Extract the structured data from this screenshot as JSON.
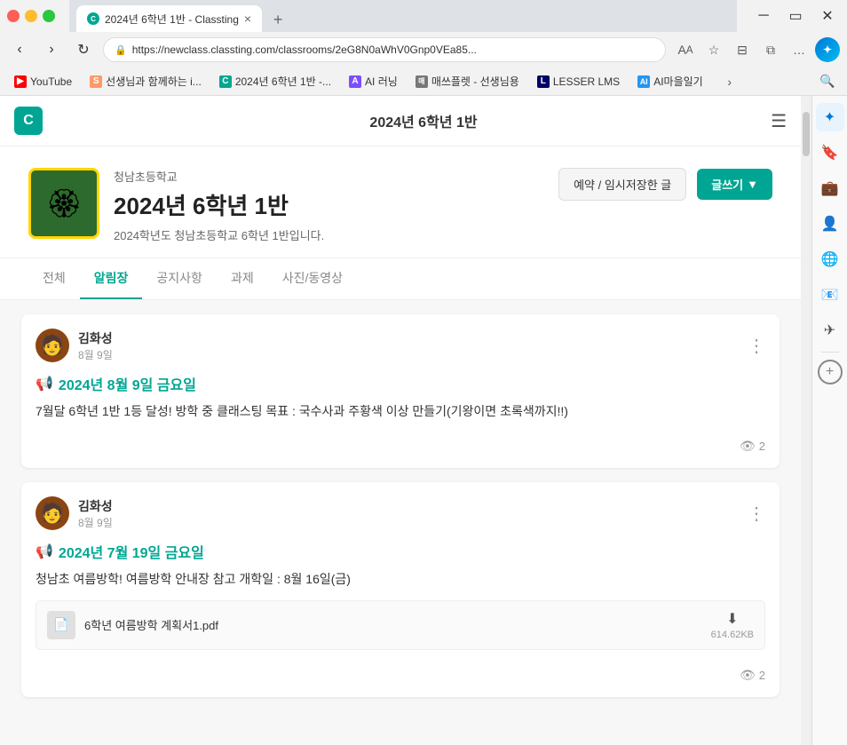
{
  "browser": {
    "tab": {
      "favicon_text": "C",
      "title": "2024년 6학년 1반 - Classting",
      "close_label": "×"
    },
    "new_tab_label": "+",
    "address": {
      "url": "https://newclass.classting.com/classrooms/2eG8N0aWhV0Gnp0VEa85...",
      "lock_icon": "🔒"
    },
    "nav": {
      "back": "‹",
      "forward": "›",
      "refresh": "↻",
      "home": "⌂"
    },
    "bar_icons": {
      "translate": "A",
      "star": "☆",
      "read": "⊟",
      "split": "⧉",
      "settings": "⚙",
      "more": "…"
    }
  },
  "bookmarks": [
    {
      "id": "youtube",
      "icon": "▶",
      "color": "bm-youtube",
      "label": "YouTube"
    },
    {
      "id": "seon",
      "icon": "S",
      "color": "bm-s",
      "label": "선생님과 함께하는 i..."
    },
    {
      "id": "classting2",
      "icon": "C",
      "color": "bm-classting",
      "label": "2024년 6학년 1반 -..."
    },
    {
      "id": "ai",
      "icon": "A",
      "color": "bm-ai",
      "label": "AI 러닝"
    },
    {
      "id": "matss",
      "icon": "매",
      "color": "bm-matss",
      "label": "매쓰플렛 - 선생님용"
    },
    {
      "id": "lesser",
      "icon": "L",
      "color": "bm-lesser",
      "label": "LESSER LMS"
    },
    {
      "id": "aimaul",
      "icon": "🤖",
      "color": "bm-ai-maul",
      "label": "AI마을일기"
    }
  ],
  "classting": {
    "logo": "C",
    "title": "2024년 6학년 1반",
    "menu_icon": "☰",
    "school": {
      "name": "청남초등학교",
      "emblem": "🏵",
      "class_name": "2024년 6학년 1반",
      "description": "2024학년도 청남초등학교 6학년 1반입니다."
    },
    "actions": {
      "draft_label": "예약 / 임시저장한 글",
      "write_label": "글쓰기",
      "write_arrow": "▼"
    },
    "tabs": [
      {
        "id": "all",
        "label": "전체"
      },
      {
        "id": "notice",
        "label": "알림장",
        "active": true
      },
      {
        "id": "announcement",
        "label": "공지사항"
      },
      {
        "id": "homework",
        "label": "과제"
      },
      {
        "id": "media",
        "label": "사진/동영상"
      }
    ],
    "posts": [
      {
        "id": "post1",
        "author": "김화성",
        "date": "8월 9일",
        "title": "2024년 8월 9일 금요일",
        "title_icon": "📢",
        "body": "7월달 6학년 1반 1등 달성! 방학 중 클래스팅 목표 : 국수사과 주황색 이상 만들기(기왕이면 초록색까지!!)",
        "views": "2",
        "attachment": null
      },
      {
        "id": "post2",
        "author": "김화성",
        "date": "8월 9일",
        "title": "2024년 7월 19일 금요일",
        "title_icon": "📢",
        "body": "청남초 여름방학! 여름방학 안내장 참고 개학일 : 8월 16일(금)",
        "views": "2",
        "attachment": {
          "name": "6학년 여름방학 계획서1.pdf",
          "size": "614.62KB"
        }
      }
    ]
  },
  "edge_sidebar": {
    "icons": [
      {
        "id": "copilot",
        "symbol": "✦",
        "active": true
      },
      {
        "id": "favorites",
        "symbol": "🔖"
      },
      {
        "id": "briefcase",
        "symbol": "💼"
      },
      {
        "id": "person",
        "symbol": "👤"
      },
      {
        "id": "globe",
        "symbol": "🌐"
      },
      {
        "id": "outlook",
        "symbol": "📧"
      },
      {
        "id": "telegram",
        "symbol": "✈"
      }
    ],
    "search_icon": "🔍",
    "add_icon": "+"
  }
}
